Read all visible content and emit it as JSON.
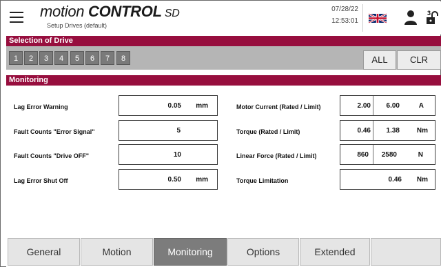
{
  "header": {
    "title_prefix": "motion ",
    "title_bold": "CONTROL",
    "title_suffix": " SD",
    "subtitle": "Setup Drives (default)",
    "date": "07/28/22",
    "time": "12:53:01",
    "language_icon": "uk-flag-icon",
    "user_icon": "user-icon",
    "lock_icon": "unlock-icon",
    "lock_badge": "3"
  },
  "drive_selection": {
    "title": "Selection of Drive",
    "drives": [
      "1",
      "2",
      "3",
      "4",
      "5",
      "6",
      "7",
      "8"
    ],
    "all_label": "ALL",
    "clr_label": "CLR"
  },
  "monitoring": {
    "title": "Monitoring",
    "left": [
      {
        "label": "Lag Error Warning",
        "value": "0.05",
        "unit": "mm"
      },
      {
        "label": "Fault Counts \"Error Signal\"",
        "value": "5",
        "unit": ""
      },
      {
        "label": "Fault Counts \"Drive OFF\"",
        "value": "10",
        "unit": ""
      },
      {
        "label": "Lag Error Shut Off",
        "value": "0.50",
        "unit": "mm"
      }
    ],
    "right": [
      {
        "label": "Motor Current (Rated / Limit)",
        "rated": "2.00",
        "limit": "6.00",
        "unit": "A"
      },
      {
        "label": "Torque (Rated / Limit)",
        "rated": "0.46",
        "limit": "1.38",
        "unit": "Nm"
      },
      {
        "label": "Linear Force (Rated / Limit)",
        "rated": "860",
        "limit": "2580",
        "unit": "N"
      }
    ],
    "torque_limitation": {
      "label": "Torque Limitation",
      "value": "0.46",
      "unit": "Nm"
    }
  },
  "tabs": [
    {
      "label": "General",
      "active": false
    },
    {
      "label": "Motion",
      "active": false
    },
    {
      "label": "Monitoring",
      "active": true
    },
    {
      "label": "Options",
      "active": false
    },
    {
      "label": "Extended",
      "active": false
    }
  ],
  "colors": {
    "accent": "#970e3e",
    "strip": "#b5b5b5",
    "drive_button": "#7a7a7a",
    "active_tab": "#7c7c7c"
  }
}
